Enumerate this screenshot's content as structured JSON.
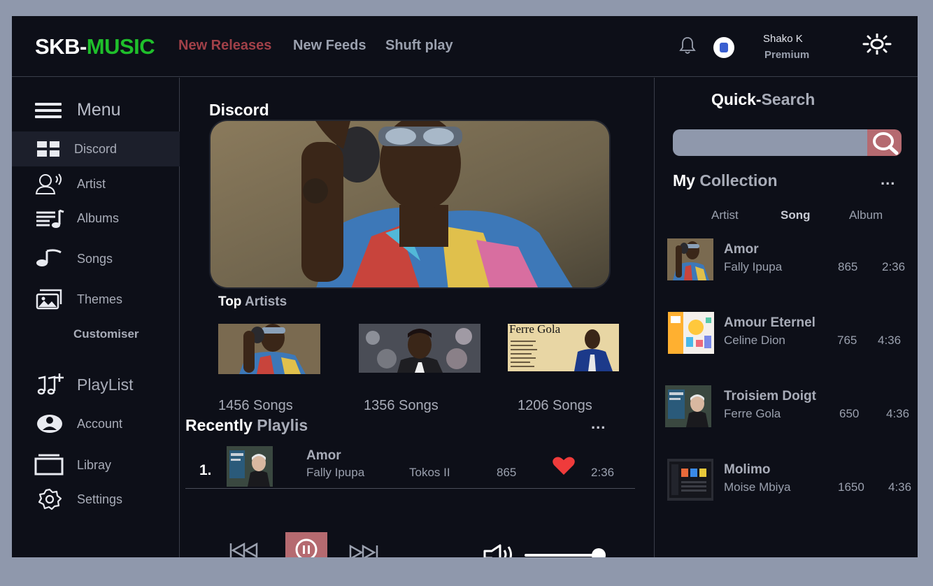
{
  "brand": {
    "part1": "SKB-",
    "part2": "MUSIC"
  },
  "nav": [
    {
      "label": "New Releases",
      "active": true
    },
    {
      "label": "New Feeds",
      "active": false
    },
    {
      "label": "Shuft play",
      "active": false
    }
  ],
  "user": {
    "name": "Shako  K",
    "plan": "Premium"
  },
  "sidebar": {
    "menu_label": "Menu",
    "items": [
      {
        "label": "Discord",
        "icon": "grid-icon",
        "active": true
      },
      {
        "label": "Artist",
        "icon": "artist-icon"
      },
      {
        "label": "Albums",
        "icon": "albums-icon"
      },
      {
        "label": "Songs",
        "icon": "music-note-icon"
      },
      {
        "label": "Themes",
        "icon": "image-icon"
      }
    ],
    "customiser": "Customiser",
    "items2": [
      {
        "label": "PlayList",
        "icon": "playlist-add-icon"
      },
      {
        "label": "Account",
        "icon": "account-icon"
      },
      {
        "label": "Libray",
        "icon": "library-icon"
      },
      {
        "label": "Settings",
        "icon": "gear-icon"
      }
    ]
  },
  "main": {
    "section_title": "Discord",
    "top_artists": {
      "title_a": "Top",
      "title_b": " Artists"
    },
    "artists": [
      {
        "songs": "1456 Songs"
      },
      {
        "songs": "1356 Songs"
      },
      {
        "songs": "1206 Songs",
        "cover_text": "Ferre Gola"
      }
    ],
    "recent": {
      "title_a": "Recently",
      "title_b": " Playlis",
      "more": "...",
      "rows": [
        {
          "num": "1.",
          "title": "Amor",
          "artist": "Fally Ipupa",
          "album": "Tokos II",
          "plays": "865",
          "liked": true,
          "duration": "2:36"
        }
      ]
    }
  },
  "player": {
    "volume": 0.95
  },
  "quick_search": {
    "title_a": "Quick-",
    "title_b": "Search",
    "placeholder": ""
  },
  "collection": {
    "title_a": "My",
    "title_b": " Collection",
    "more": "...",
    "tabs": [
      {
        "label": "Artist",
        "active": false
      },
      {
        "label": "Song",
        "active": true
      },
      {
        "label": "Album",
        "active": false
      }
    ],
    "items": [
      {
        "title": "Amor",
        "artist": "Fally Ipupa",
        "plays": "865",
        "duration": "2:36"
      },
      {
        "title": "Amour Eternel",
        "artist": "Celine Dion",
        "plays": "765",
        "duration": "4:36"
      },
      {
        "title": "Troisiem Doigt",
        "artist": "Ferre Gola",
        "plays": "650",
        "duration": "4:36"
      },
      {
        "title": "Molimo",
        "artist": "Moise Mbiya",
        "plays": "1650",
        "duration": "4:36"
      }
    ]
  },
  "colors": {
    "accent_green": "#1fbf2b",
    "accent_red": "#a04048",
    "button_pink": "#b56a70",
    "background": "#0d0f18"
  }
}
